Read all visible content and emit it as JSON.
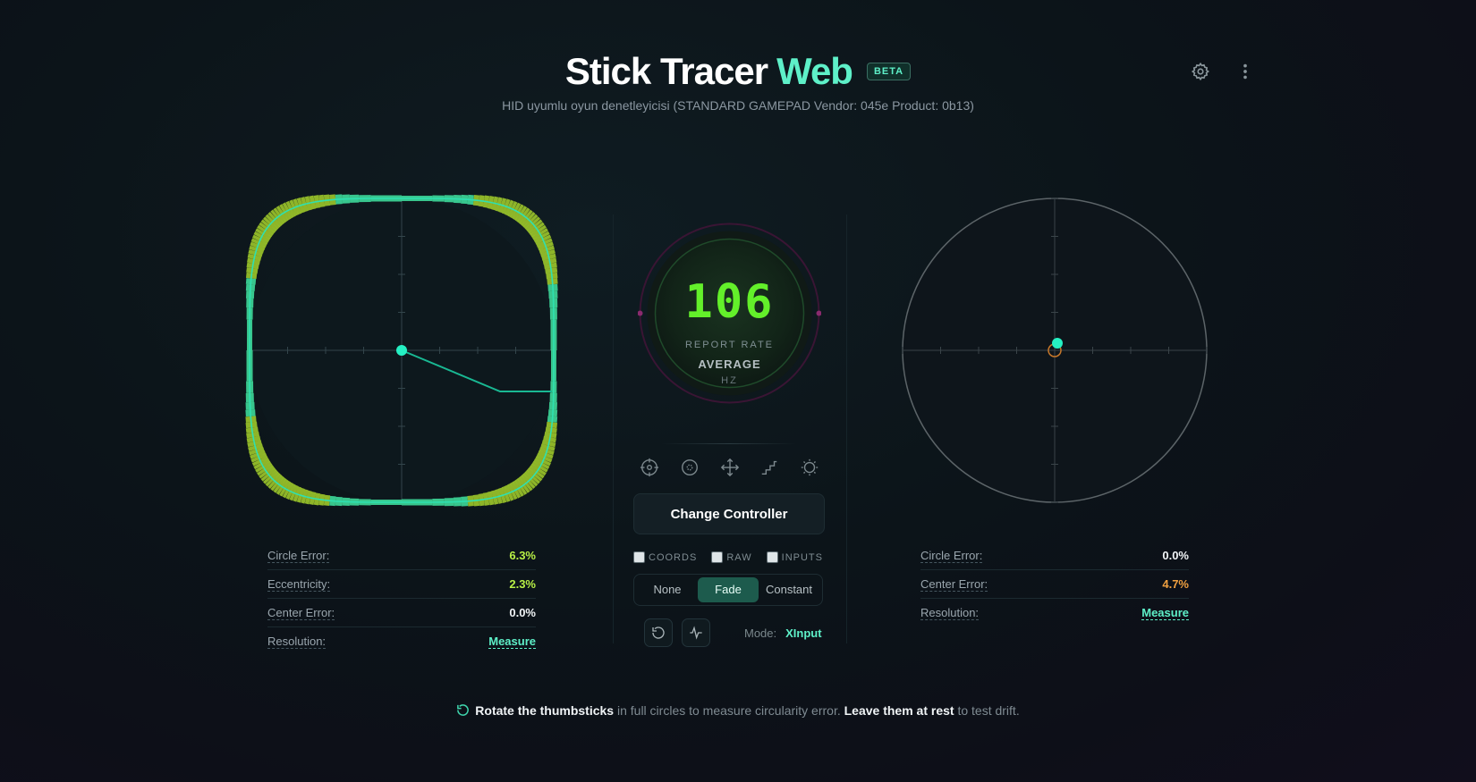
{
  "header": {
    "title_main": "Stick Tracer",
    "title_accent": "Web",
    "badge": "BETA",
    "subtitle": "HID uyumlu oyun denetleyicisi (STANDARD GAMEPAD Vendor: 045e Product: 0b13)"
  },
  "top_icons": [
    "gear-icon",
    "more-vertical-icon"
  ],
  "colors": {
    "accent": "#5ef0c8",
    "report_rate": "#63f02a",
    "warn": "#f0a040",
    "good": "#b8f046"
  },
  "left_stick": {
    "stats": [
      {
        "label": "Circle Error:",
        "value": "6.3%",
        "tone": "yg"
      },
      {
        "label": "Eccentricity:",
        "value": "2.3%",
        "tone": "yg"
      },
      {
        "label": "Center Error:",
        "value": "0.0%",
        "tone": "white"
      },
      {
        "label": "Resolution:",
        "value": "Measure",
        "tone": "link"
      }
    ]
  },
  "right_stick": {
    "stats": [
      {
        "label": "Circle Error:",
        "value": "0.0%",
        "tone": "white"
      },
      {
        "label": "Center Error:",
        "value": "4.7%",
        "tone": "orange"
      },
      {
        "label": "Resolution:",
        "value": "Measure",
        "tone": "link"
      }
    ]
  },
  "gauge": {
    "value": "106",
    "label": "REPORT RATE",
    "mode": "AVERAGE",
    "unit": "HZ"
  },
  "tools": [
    "crosshair-icon",
    "deadzone-icon",
    "move-icon",
    "steps-icon",
    "sun-icon"
  ],
  "change_controller": "Change Controller",
  "checkboxes": [
    "COORDS",
    "RAW",
    "INPUTS"
  ],
  "trail_modes": {
    "options": [
      "None",
      "Fade",
      "Constant"
    ],
    "selected": "Fade"
  },
  "mode": {
    "label": "Mode:",
    "value": "XInput"
  },
  "hint": {
    "b1": "Rotate the thumbsticks",
    "t1": " in full circles to measure circularity error. ",
    "b2": "Leave them at rest",
    "t2": " to test drift."
  }
}
